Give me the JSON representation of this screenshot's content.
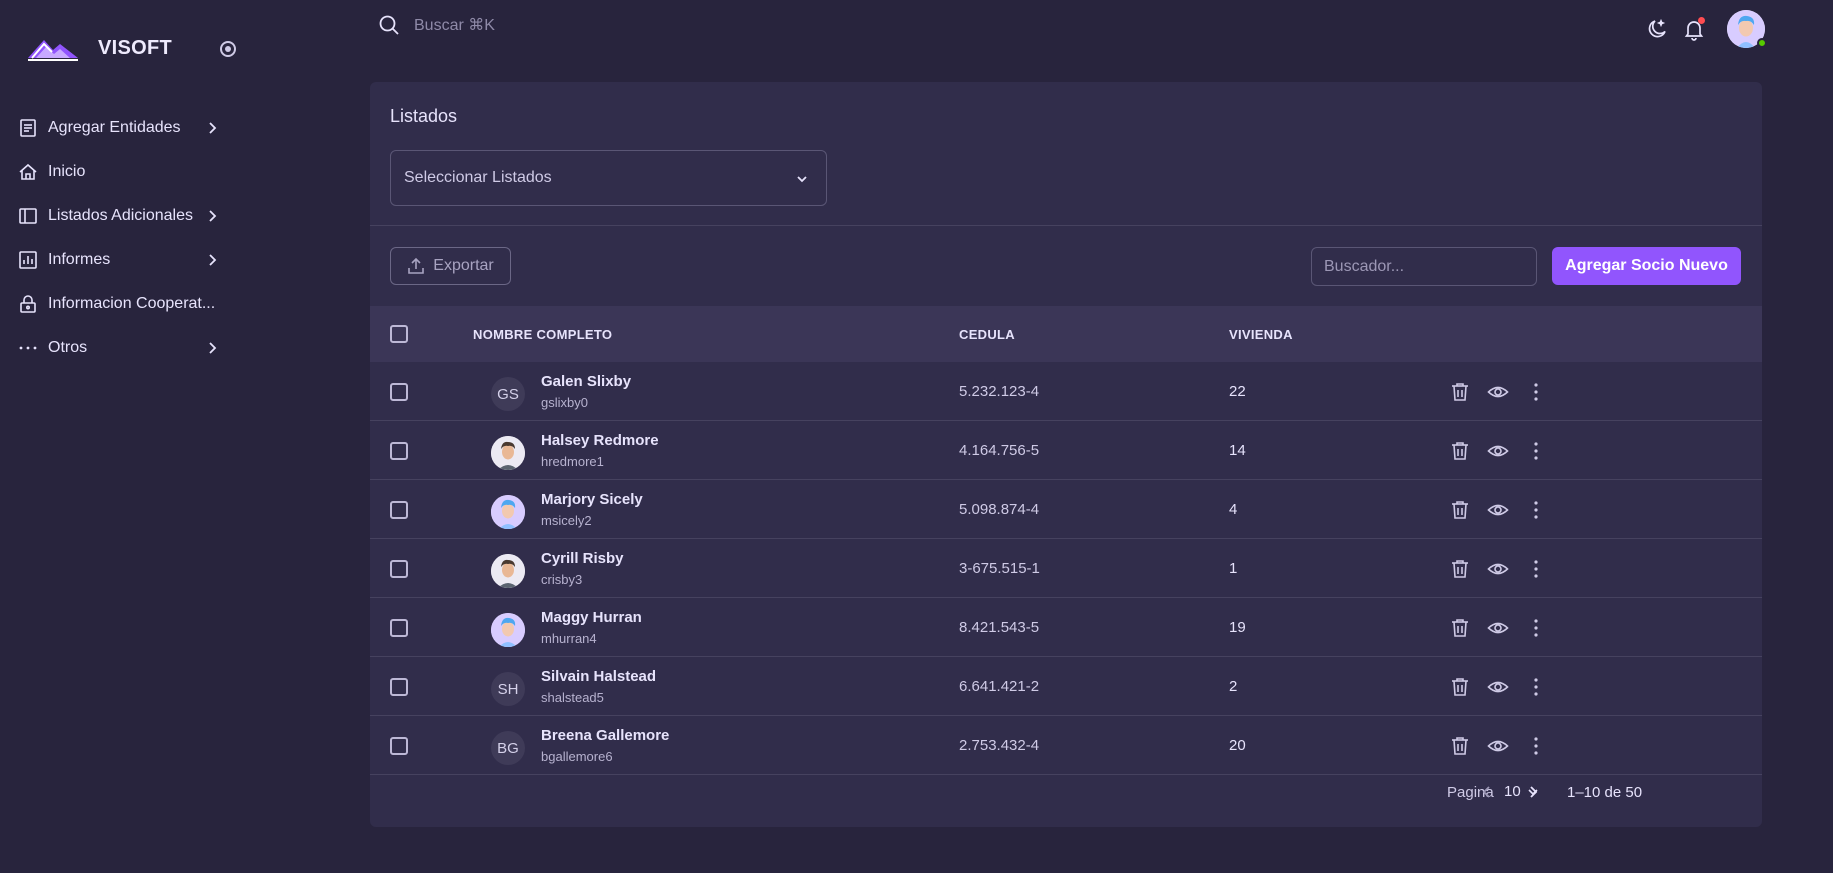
{
  "brand": {
    "name": "VISOFT"
  },
  "topbar": {
    "search_placeholder": "Buscar ⌘K"
  },
  "sidebar": {
    "items": [
      {
        "label": "Agregar Entidades",
        "icon": "document-icon",
        "has_submenu": true
      },
      {
        "label": "Inicio",
        "icon": "home-icon",
        "has_submenu": false
      },
      {
        "label": "Listados Adicionales",
        "icon": "layout-icon",
        "has_submenu": true
      },
      {
        "label": "Informes",
        "icon": "chart-icon",
        "has_submenu": true
      },
      {
        "label": "Informacion Cooperat...",
        "icon": "lock-icon",
        "has_submenu": false
      },
      {
        "label": "Otros",
        "icon": "dots-icon",
        "has_submenu": true
      }
    ]
  },
  "card": {
    "title": "Listados",
    "select_label": "Seleccionar Listados",
    "export_label": "Exportar",
    "search_placeholder": "Buscador...",
    "add_label": "Agregar Socio Nuevo"
  },
  "table": {
    "headers": {
      "name": "NOMBRE COMPLETO",
      "cedula": "CEDULA",
      "vivienda": "VIVIENDA"
    },
    "rows": [
      {
        "name": "Galen Slixby",
        "username": "gslixby0",
        "cedula": "5.232.123-4",
        "vivienda": "22",
        "initials": "GS",
        "avatar": "initials"
      },
      {
        "name": "Halsey Redmore",
        "username": "hredmore1",
        "cedula": "4.164.756-5",
        "vivienda": "14",
        "initials": "",
        "avatar": "photo-male"
      },
      {
        "name": "Marjory Sicely",
        "username": "msicely2",
        "cedula": "5.098.874-4",
        "vivienda": "4",
        "initials": "",
        "avatar": "photo-blue"
      },
      {
        "name": "Cyrill Risby",
        "username": "crisby3",
        "cedula": "3-675.515-1",
        "vivienda": "1",
        "initials": "",
        "avatar": "photo-male"
      },
      {
        "name": "Maggy Hurran",
        "username": "mhurran4",
        "cedula": "8.421.543-5",
        "vivienda": "19",
        "initials": "",
        "avatar": "photo-blue"
      },
      {
        "name": "Silvain Halstead",
        "username": "shalstead5",
        "cedula": "6.641.421-2",
        "vivienda": "2",
        "initials": "SH",
        "avatar": "initials"
      },
      {
        "name": "Breena Gallemore",
        "username": "bgallemore6",
        "cedula": "2.753.432-4",
        "vivienda": "20",
        "initials": "BG",
        "avatar": "initials"
      }
    ]
  },
  "pagination": {
    "rows_label": "Pagina",
    "rows_per_page": "10",
    "range": "1–10 de 50"
  },
  "colors": {
    "primary": "#9155fd",
    "background": "#28243d",
    "card": "#312d4b",
    "online": "#56ca00",
    "notification": "#ff4c51"
  }
}
